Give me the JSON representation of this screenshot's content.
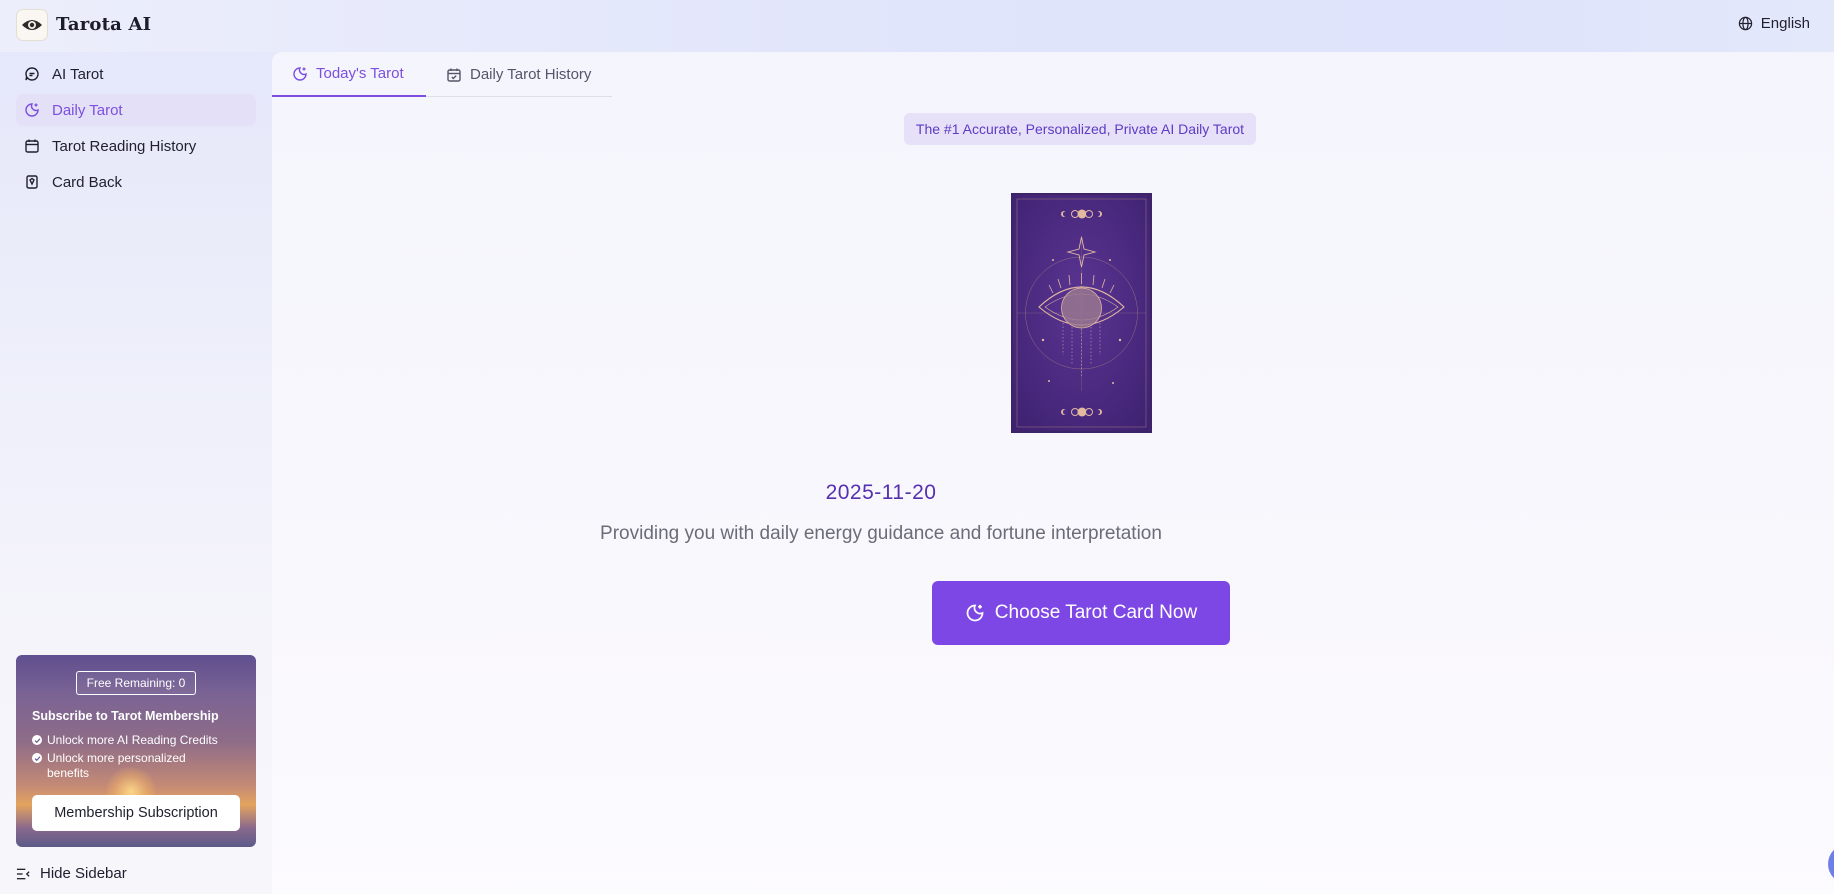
{
  "header": {
    "brand": "Tarota AI",
    "language": "English"
  },
  "sidebar": {
    "items": [
      {
        "label": "AI Tarot",
        "icon": "chat-icon",
        "active": false
      },
      {
        "label": "Daily Tarot",
        "icon": "moon-star-icon",
        "active": true
      },
      {
        "label": "Tarot Reading History",
        "icon": "calendar-icon",
        "active": false
      },
      {
        "label": "Card Back",
        "icon": "card-icon",
        "active": false
      }
    ],
    "promo": {
      "free_remaining": "Free Remaining: 0",
      "title": "Subscribe to Tarot Membership",
      "benefits": [
        "Unlock more AI Reading Credits",
        "Unlock more personalized benefits"
      ],
      "button": "Membership Subscription"
    },
    "hide_label": "Hide Sidebar"
  },
  "main": {
    "tabs": [
      {
        "label": "Today's Tarot",
        "icon": "moon-star-icon",
        "active": true
      },
      {
        "label": "Daily Tarot History",
        "icon": "calendar-check-icon",
        "active": false
      }
    ],
    "tagline": "The #1 Accurate, Personalized, Private AI Daily Tarot",
    "date": "2025-11-20",
    "subtitle": "Providing you with daily energy guidance and fortune interpretation",
    "cta": "Choose Tarot Card Now"
  },
  "colors": {
    "accent": "#7d47e6",
    "accent_text": "#7b4fe0",
    "card": "#4a2a82",
    "date": "#5530b0"
  }
}
